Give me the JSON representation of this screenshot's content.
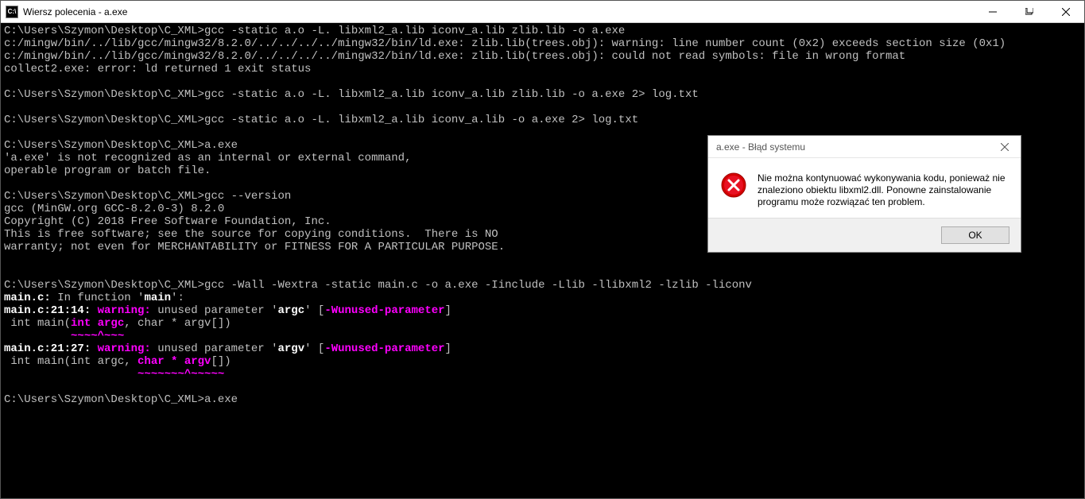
{
  "window": {
    "title": "Wiersz polecenia - a.exe",
    "icon_label": "C:\\"
  },
  "terminal": {
    "lines": [
      {
        "segs": [
          {
            "t": "C:\\Users\\Szymon\\Desktop\\C_XML>gcc -static a.o -L. libxml2_a.lib iconv_a.lib zlib.lib -o a.exe"
          }
        ]
      },
      {
        "segs": [
          {
            "t": "c:/mingw/bin/../lib/gcc/mingw32/8.2.0/../../../../mingw32/bin/ld.exe: zlib.lib(trees.obj): warning: line number count (0x2) exceeds section size (0x1)"
          }
        ]
      },
      {
        "segs": [
          {
            "t": "c:/mingw/bin/../lib/gcc/mingw32/8.2.0/../../../../mingw32/bin/ld.exe: zlib.lib(trees.obj): could not read symbols: file in wrong format"
          }
        ]
      },
      {
        "segs": [
          {
            "t": "collect2.exe: error: ld returned 1 exit status"
          }
        ]
      },
      {
        "segs": [
          {
            "t": ""
          }
        ]
      },
      {
        "segs": [
          {
            "t": "C:\\Users\\Szymon\\Desktop\\C_XML>gcc -static a.o -L. libxml2_a.lib iconv_a.lib zlib.lib -o a.exe 2> log.txt"
          }
        ]
      },
      {
        "segs": [
          {
            "t": ""
          }
        ]
      },
      {
        "segs": [
          {
            "t": "C:\\Users\\Szymon\\Desktop\\C_XML>gcc -static a.o -L. libxml2_a.lib iconv_a.lib -o a.exe 2> log.txt"
          }
        ]
      },
      {
        "segs": [
          {
            "t": ""
          }
        ]
      },
      {
        "segs": [
          {
            "t": "C:\\Users\\Szymon\\Desktop\\C_XML>a.exe"
          }
        ]
      },
      {
        "segs": [
          {
            "t": "'a.exe' is not recognized as an internal or external command,"
          }
        ]
      },
      {
        "segs": [
          {
            "t": "operable program or batch file."
          }
        ]
      },
      {
        "segs": [
          {
            "t": ""
          }
        ]
      },
      {
        "segs": [
          {
            "t": "C:\\Users\\Szymon\\Desktop\\C_XML>gcc --version"
          }
        ]
      },
      {
        "segs": [
          {
            "t": "gcc (MinGW.org GCC-8.2.0-3) 8.2.0"
          }
        ]
      },
      {
        "segs": [
          {
            "t": "Copyright (C) 2018 Free Software Foundation, Inc."
          }
        ]
      },
      {
        "segs": [
          {
            "t": "This is free software; see the source for copying conditions.  There is NO"
          }
        ]
      },
      {
        "segs": [
          {
            "t": "warranty; not even for MERCHANTABILITY or FITNESS FOR A PARTICULAR PURPOSE."
          }
        ]
      },
      {
        "segs": [
          {
            "t": ""
          }
        ]
      },
      {
        "segs": [
          {
            "t": ""
          }
        ]
      },
      {
        "segs": [
          {
            "t": "C:\\Users\\Szymon\\Desktop\\C_XML>gcc -Wall -Wextra -static main.c -o a.exe -Iinclude -Llib -llibxml2 -lzlib -liconv"
          }
        ]
      },
      {
        "segs": [
          {
            "t": "main.c:",
            "c": "bold"
          },
          {
            "t": " In function '"
          },
          {
            "t": "main",
            "c": "bold"
          },
          {
            "t": "':"
          }
        ]
      },
      {
        "segs": [
          {
            "t": "main.c:21:14:",
            "c": "bold"
          },
          {
            "t": " "
          },
          {
            "t": "warning:",
            "c": "magenta"
          },
          {
            "t": " unused parameter '"
          },
          {
            "t": "argc",
            "c": "bold"
          },
          {
            "t": "' ["
          },
          {
            "t": "-Wunused-parameter",
            "c": "magenta"
          },
          {
            "t": "]"
          }
        ]
      },
      {
        "segs": [
          {
            "t": " int main("
          },
          {
            "t": "int argc",
            "c": "magenta"
          },
          {
            "t": ", char * argv[])"
          }
        ]
      },
      {
        "segs": [
          {
            "t": "          "
          },
          {
            "t": "~~~~^~~~",
            "c": "squiggle"
          }
        ]
      },
      {
        "segs": [
          {
            "t": "main.c:21:27:",
            "c": "bold"
          },
          {
            "t": " "
          },
          {
            "t": "warning:",
            "c": "magenta"
          },
          {
            "t": " unused parameter '"
          },
          {
            "t": "argv",
            "c": "bold"
          },
          {
            "t": "' ["
          },
          {
            "t": "-Wunused-parameter",
            "c": "magenta"
          },
          {
            "t": "]"
          }
        ]
      },
      {
        "segs": [
          {
            "t": " int main(int argc, "
          },
          {
            "t": "char * argv",
            "c": "magenta"
          },
          {
            "t": "[])"
          }
        ]
      },
      {
        "segs": [
          {
            "t": "                    "
          },
          {
            "t": "~~~~~~~^~~~~~",
            "c": "squiggle"
          }
        ]
      },
      {
        "segs": [
          {
            "t": ""
          }
        ]
      },
      {
        "segs": [
          {
            "t": "C:\\Users\\Szymon\\Desktop\\C_XML>a.exe"
          }
        ]
      }
    ]
  },
  "dialog": {
    "title": "a.exe - Błąd systemu",
    "message": "Nie można kontynuować wykonywania kodu, ponieważ nie znaleziono obiektu libxml2.dll. Ponowne zainstalowanie programu może rozwiązać ten problem.",
    "ok": "OK"
  }
}
